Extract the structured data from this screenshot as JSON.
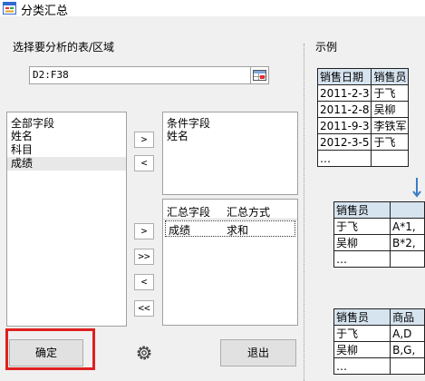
{
  "window": {
    "title": "分类汇总"
  },
  "range_section": {
    "label": "选择要分析的表/区域",
    "value": "D2:F38"
  },
  "all_fields": {
    "header": "全部字段",
    "items": [
      "姓名",
      "科目",
      "成绩"
    ],
    "selected_index": 2
  },
  "condition_fields": {
    "header": "条件字段",
    "items": [
      "姓名"
    ]
  },
  "summary_grid": {
    "columns": [
      "汇总字段",
      "汇总方式"
    ],
    "rows": [
      {
        "field": "成绩",
        "method": "求和"
      }
    ]
  },
  "move_buttons": {
    "add": ">",
    "remove": "<",
    "add_one": ">",
    "add_all": ">>",
    "remove_one": "<",
    "remove_all": "<<"
  },
  "buttons": {
    "ok": "确定",
    "exit": "退出"
  },
  "example": {
    "label": "示例",
    "table1": {
      "headers": [
        "销售日期",
        "销售员"
      ],
      "rows": [
        [
          "2011-2-3",
          "于飞"
        ],
        [
          "2011-2-8",
          "吴柳"
        ],
        [
          "2011-9-3",
          "李铁军"
        ],
        [
          "2012-3-5",
          "于飞"
        ],
        [
          "…",
          ""
        ]
      ]
    },
    "table2": {
      "headers": [
        "销售员",
        ""
      ],
      "rows": [
        [
          "于飞",
          "A*1,"
        ],
        [
          "吴柳",
          "B*2,"
        ],
        [
          "…",
          ""
        ]
      ]
    },
    "table3": {
      "headers": [
        "销售员",
        "商品"
      ],
      "rows": [
        [
          "于飞",
          "A,D"
        ],
        [
          "吴柳",
          "B,G,"
        ],
        [
          "…",
          ""
        ]
      ]
    }
  },
  "colors": {
    "highlight": "#e02020",
    "arrow": "#3a7cc4",
    "table_header": "#d6e4f0"
  }
}
